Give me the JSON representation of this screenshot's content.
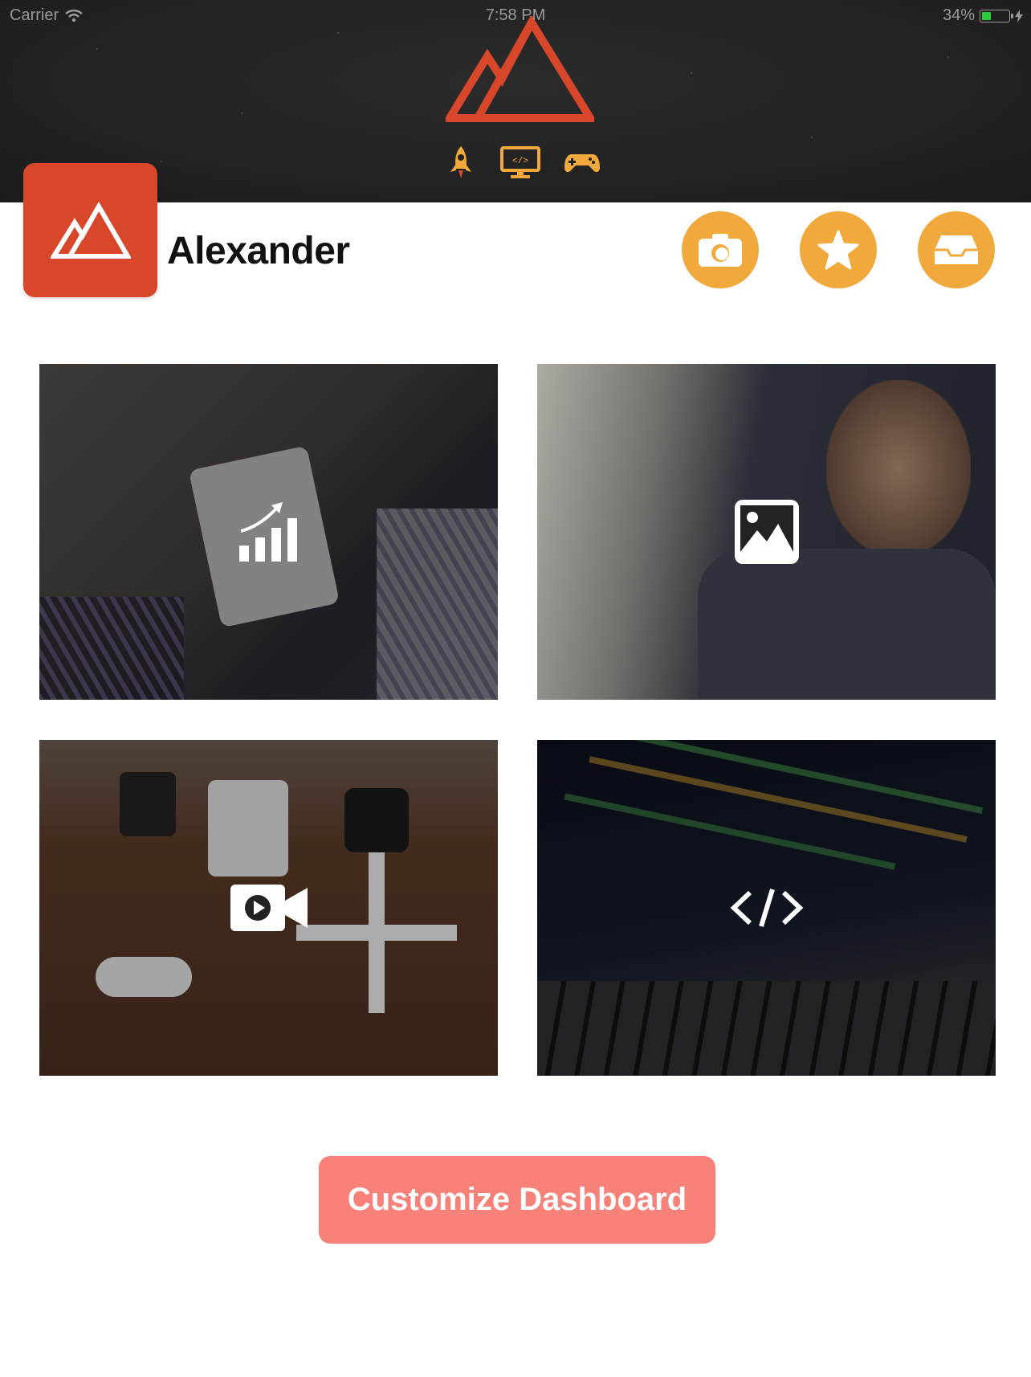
{
  "status_bar": {
    "carrier": "Carrier",
    "time": "7:58 PM",
    "battery_percent": "34%",
    "battery_level": 0.34,
    "wifi_icon": "wifi-icon"
  },
  "header": {
    "logo": "mountain-logo",
    "nav_icons": [
      "rocket-icon",
      "code-monitor-icon",
      "gamepad-icon"
    ],
    "nav_monitor_text": "</>"
  },
  "profile": {
    "avatar_icon": "mountain-logo",
    "name": "Alexander"
  },
  "actions": [
    {
      "icon": "camera-icon"
    },
    {
      "icon": "star-icon"
    },
    {
      "icon": "inbox-icon"
    }
  ],
  "tiles": [
    {
      "id": "analytics",
      "icon": "chart-icon",
      "photo": "tablet with charts"
    },
    {
      "id": "photos",
      "icon": "image-icon",
      "photo": "man on phone"
    },
    {
      "id": "videos",
      "icon": "video-camera-icon",
      "photo": "camera gear flat lay"
    },
    {
      "id": "code",
      "icon": "code-icon",
      "photo": "code on laptop"
    }
  ],
  "customize_button": {
    "label": "Customize Dashboard"
  },
  "colors": {
    "header_bg": "#222222",
    "brand": "#d9472b",
    "accent": "#f2a93b",
    "button": "#f88279"
  }
}
